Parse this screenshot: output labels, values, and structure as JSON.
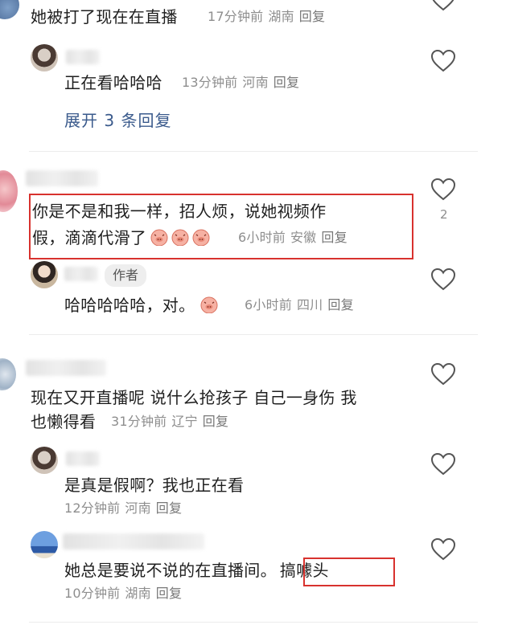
{
  "comments": {
    "c0": {
      "text": "她被打了现在在直播",
      "time": "17分钟前",
      "location": "湖南",
      "reply": "回复"
    },
    "c0_r1": {
      "text": "正在看哈哈哈",
      "time": "13分钟前",
      "location": "河南",
      "reply": "回复"
    },
    "c0_expand": "展开 3 条回复",
    "c1": {
      "text_line1": "你是不是和我一样，招人烦，说她视频作",
      "text_line2": "假，滴滴代滑了",
      "time": "6小时前",
      "location": "安徽",
      "reply": "回复",
      "likes": "2"
    },
    "c1_r1": {
      "badge": "作者",
      "text": "哈哈哈哈哈，对。",
      "time": "6小时前",
      "location": "四川",
      "reply": "回复"
    },
    "c2": {
      "text_line1": "现在又开直播呢 说什么抢孩子 自己一身伤 我",
      "text_line2": "也懒得看",
      "time": "31分钟前",
      "location": "辽宁",
      "reply": "回复"
    },
    "c2_r1": {
      "text": "是真是假啊？我也正在看",
      "time": "12分钟前",
      "location": "河南",
      "reply": "回复"
    },
    "c2_r2": {
      "text": "她总是要说不说的在直播间。",
      "highlight": "搞噱头",
      "time": "10分钟前",
      "location": "湖南",
      "reply": "回复"
    }
  },
  "icons": {
    "like": "heart-outline-icon",
    "emoji": "pig-face-emoji-icon"
  },
  "colors": {
    "highlight_box": "#d8322e",
    "meta_text": "#8e8e8e",
    "link": "#3a5a8c"
  }
}
